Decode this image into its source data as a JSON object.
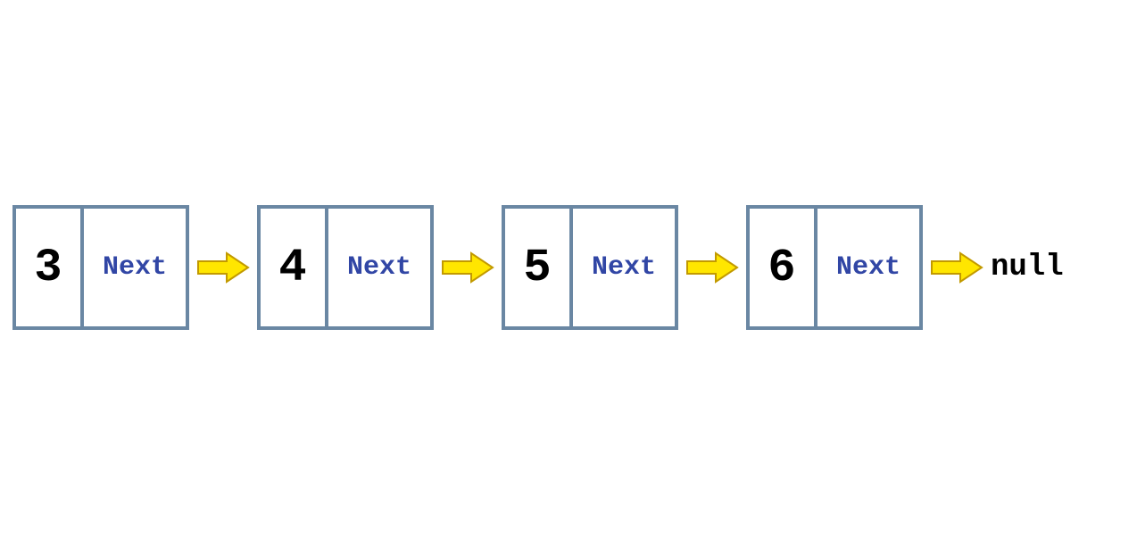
{
  "diagram": {
    "type": "singly-linked-list",
    "nodes": [
      {
        "value": "3",
        "pointer_label": "Next"
      },
      {
        "value": "4",
        "pointer_label": "Next"
      },
      {
        "value": "5",
        "pointer_label": "Next"
      },
      {
        "value": "6",
        "pointer_label": "Next"
      }
    ],
    "terminator": "null",
    "colors": {
      "border": "#6a87a3",
      "value_text": "#000000",
      "pointer_text": "#3146a5",
      "arrow_fill": "#ffe600",
      "arrow_stroke": "#c29a00"
    }
  }
}
